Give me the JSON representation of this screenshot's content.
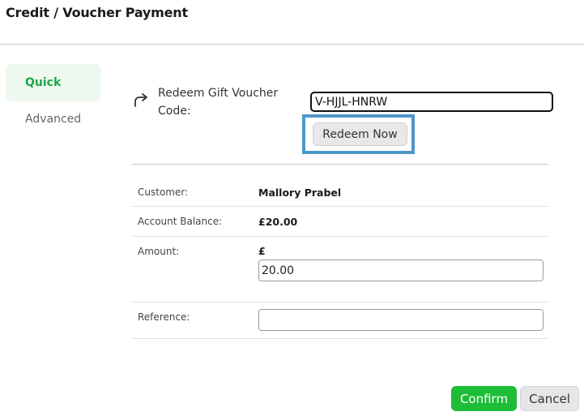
{
  "header": {
    "title": "Credit / Voucher Payment"
  },
  "sidebar": {
    "items": [
      {
        "label": "Quick",
        "active": true
      },
      {
        "label": "Advanced",
        "active": false
      }
    ]
  },
  "redeem": {
    "icon": "redirect-arrow-icon",
    "label": "Redeem Gift Voucher Code:",
    "code_value": "V-HJJL-HNRW",
    "button_label": "Redeem Now",
    "highlight_color": "#4e97c9"
  },
  "details": {
    "customer_label": "Customer:",
    "customer_value": "Mallory Prabel",
    "balance_label": "Account Balance:",
    "balance_value": "£20.00",
    "amount_label": "Amount:",
    "currency_symbol": "£",
    "amount_value": "20.00",
    "reference_label": "Reference:",
    "reference_value": ""
  },
  "footer": {
    "confirm_label": "Confirm",
    "cancel_label": "Cancel",
    "confirm_color": "#1ebd38"
  }
}
